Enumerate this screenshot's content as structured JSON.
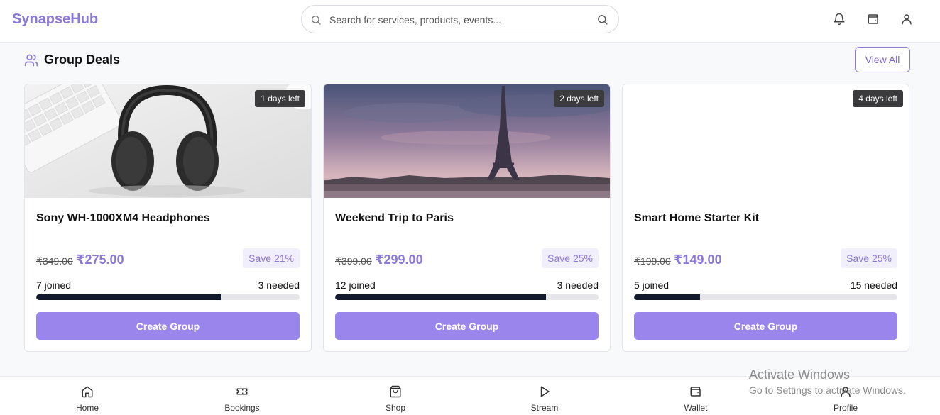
{
  "app": {
    "brand": "SynapseHub"
  },
  "search": {
    "placeholder": "Search for services, products, events..."
  },
  "header_icons": [
    "bell-icon",
    "wallet-icon",
    "user-icon"
  ],
  "section": {
    "title": "Group Deals",
    "view_all_label": "View All"
  },
  "deals": [
    {
      "title": "Sony WH-1000XM4 Headphones",
      "days_left": "1 days left",
      "original_price": "₹349.00",
      "price": "₹275.00",
      "save": "Save 21%",
      "joined": "7 joined",
      "needed": "3 needed",
      "progress": 0.7,
      "cta": "Create Group"
    },
    {
      "title": "Weekend Trip to Paris",
      "days_left": "2 days left",
      "original_price": "₹399.00",
      "price": "₹299.00",
      "save": "Save 25%",
      "joined": "12 joined",
      "needed": "3 needed",
      "progress": 0.8,
      "cta": "Create Group"
    },
    {
      "title": "Smart Home Starter Kit",
      "days_left": "4 days left",
      "original_price": "₹199.00",
      "price": "₹149.00",
      "save": "Save 25%",
      "joined": "5 joined",
      "needed": "15 needed",
      "progress": 0.25,
      "cta": "Create Group"
    }
  ],
  "bottom_nav": [
    {
      "label": "Home",
      "icon": "home-icon"
    },
    {
      "label": "Bookings",
      "icon": "ticket-icon"
    },
    {
      "label": "Shop",
      "icon": "shopping-bag-icon"
    },
    {
      "label": "Stream",
      "icon": "play-icon"
    },
    {
      "label": "Wallet",
      "icon": "wallet-icon"
    },
    {
      "label": "Profile",
      "icon": "user-icon"
    }
  ],
  "watermark": {
    "line1": "Activate Windows",
    "line2": "Go to Settings to activate Windows."
  },
  "colors": {
    "accent": "#8b78d9",
    "button": "#9985ec",
    "progress": "#141a2e",
    "badge": "#3b3b3e"
  }
}
